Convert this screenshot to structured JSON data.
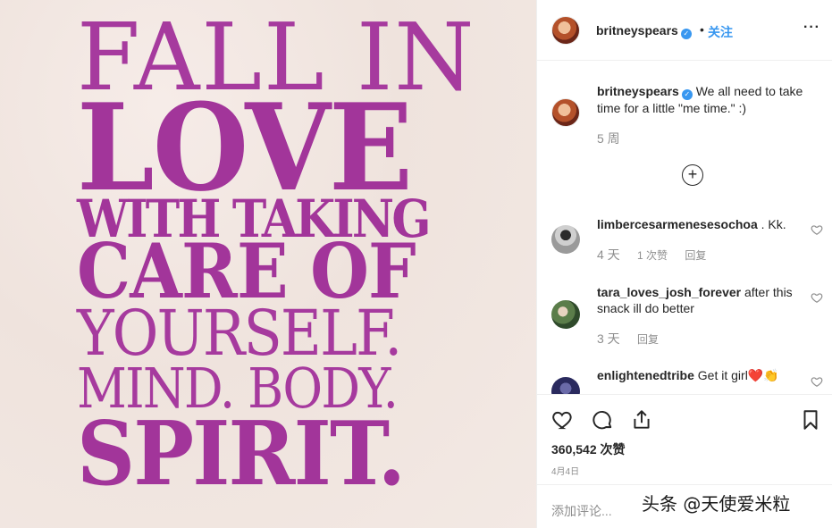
{
  "post": {
    "quote_lines": [
      "FALL IN",
      "LOVE",
      "WITH TAKING",
      "CARE OF",
      "YOURSELF.",
      "MIND. BODY.",
      "SPIRIT."
    ]
  },
  "header": {
    "username": "britneyspears",
    "dot": "•",
    "follow_label": "关注",
    "more_label": "···"
  },
  "caption": {
    "username": "britneyspears",
    "text": "We all need to take time for a little \"me time.\" :)",
    "time": "5 周"
  },
  "load_more_label": "+",
  "comments": [
    {
      "username": "limbercesarmenesesochoa",
      "text": ". Kk.",
      "time": "4 天",
      "likes": "1 次赞",
      "reply": "回复"
    },
    {
      "username": "tara_loves_josh_forever",
      "text": "after this snack ill do better",
      "time": "3 天",
      "reply": "回复"
    },
    {
      "username": "enlightenedtribe",
      "text": "Get it girl❤️👏"
    }
  ],
  "actions": {
    "likes": "360,542 次赞",
    "date": "4月4日",
    "add_comment_placeholder": "添加评论..."
  },
  "watermark": "头条 @天使爱米粒",
  "colors": {
    "quote_purple": "#a2359a",
    "verified_blue": "#3897f0",
    "link_blue": "#3897f0",
    "muted_gray": "#8e8e8e"
  },
  "icons": [
    "heart-icon",
    "comment-icon",
    "share-icon",
    "bookmark-icon",
    "verified-badge-icon",
    "add-circle-icon",
    "more-options-icon"
  ]
}
